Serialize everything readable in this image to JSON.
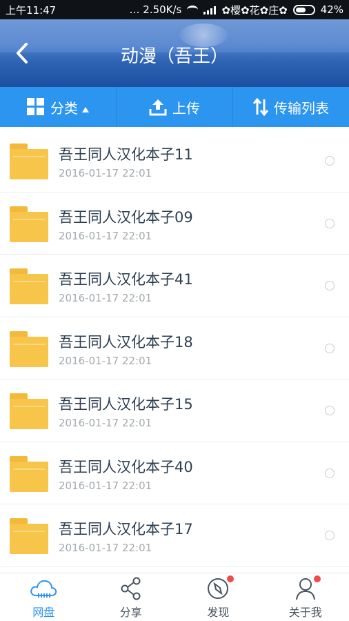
{
  "status_bar": {
    "time": "上午11:47",
    "speed": "… 2.50K/s",
    "carrier": "✿樱✿花✿庄✿",
    "battery": "42%"
  },
  "header": {
    "title": "动漫（吾王）",
    "back_icon": "chevron-left-icon"
  },
  "toolbar": {
    "category_label": "分类",
    "upload_label": "上传",
    "transfer_label": "传输列表"
  },
  "files": [
    {
      "name": "吾王同人汉化本子11",
      "date": "2016-01-17  22:01"
    },
    {
      "name": "吾王同人汉化本子09",
      "date": "2016-01-17  22:01"
    },
    {
      "name": "吾王同人汉化本子41",
      "date": "2016-01-17  22:01"
    },
    {
      "name": "吾王同人汉化本子18",
      "date": "2016-01-17  22:01"
    },
    {
      "name": "吾王同人汉化本子15",
      "date": "2016-01-17  22:01"
    },
    {
      "name": "吾王同人汉化本子40",
      "date": "2016-01-17  22:01"
    },
    {
      "name": "吾王同人汉化本子17",
      "date": "2016-01-17  22:01"
    }
  ],
  "bottom_nav": {
    "items": [
      {
        "label": "网盘",
        "icon": "cloud-icon",
        "active": true
      },
      {
        "label": "分享",
        "icon": "share-icon",
        "active": false
      },
      {
        "label": "发现",
        "icon": "compass-icon",
        "active": false,
        "badge": true
      },
      {
        "label": "关于我",
        "icon": "user-icon",
        "active": false,
        "badge": true
      }
    ]
  },
  "colors": {
    "accent": "#2b95ef",
    "folder": "#f6c54a",
    "badge": "#ef4b4b"
  }
}
